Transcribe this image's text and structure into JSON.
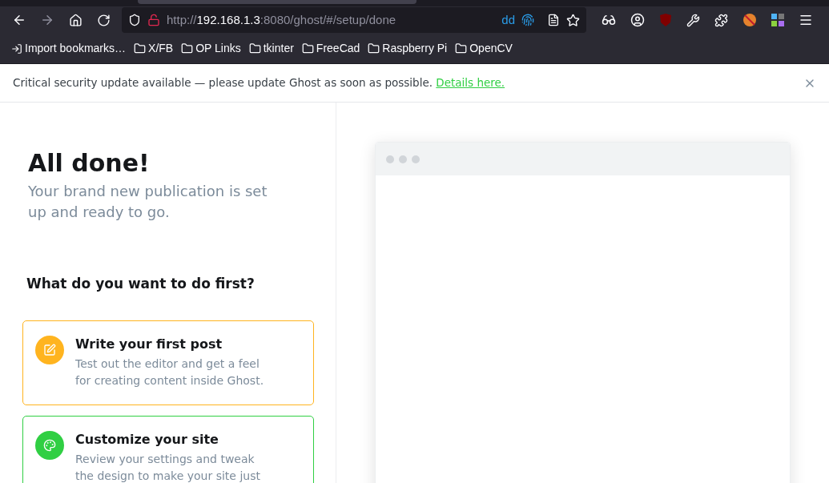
{
  "browser": {
    "url": {
      "scheme": "http://",
      "host": "192.168.1.3",
      "rest": ":8080/ghost/#/setup/done"
    },
    "url_badge": "dd",
    "bookmarks": [
      {
        "label": "Import bookmarks…",
        "kind": "import"
      },
      {
        "label": "X/FB",
        "kind": "folder"
      },
      {
        "label": "OP Links",
        "kind": "folder"
      },
      {
        "label": "tkinter",
        "kind": "folder"
      },
      {
        "label": "FreeCad",
        "kind": "folder"
      },
      {
        "label": "Raspberry Pi",
        "kind": "folder"
      },
      {
        "label": "OpenCV",
        "kind": "folder"
      }
    ]
  },
  "banner": {
    "message": "Critical security update available — please update Ghost as soon as possible.",
    "link": "Details here."
  },
  "setup": {
    "title": "All done!",
    "subtitle": "Your brand new publication is set up and ready to go.",
    "question": "What do you want to do first?",
    "options": [
      {
        "title": "Write your first post",
        "description": "Test out the editor and get a feel for creating content inside Ghost.",
        "color": "#ffb41f",
        "kind": "write"
      },
      {
        "title": "Customize your site",
        "description": "Review your settings and tweak the design to make your site just",
        "color": "#30cf43",
        "kind": "design"
      }
    ]
  }
}
